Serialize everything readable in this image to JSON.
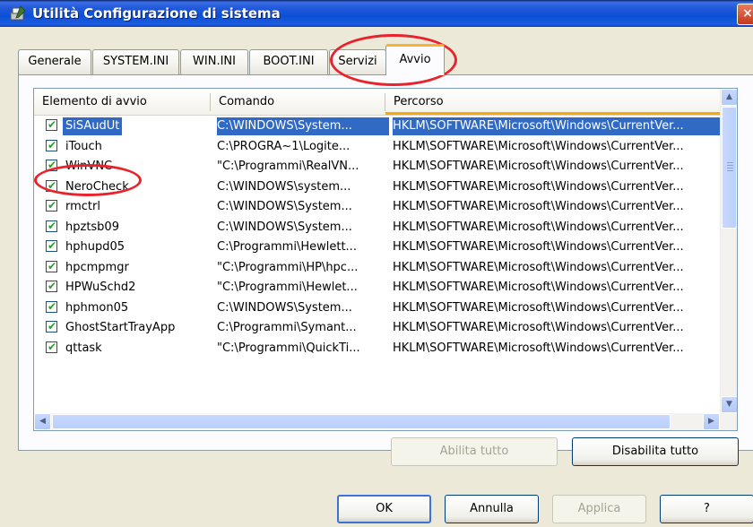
{
  "window": {
    "title": "Utilità Configurazione di sistema",
    "close_label": "×"
  },
  "tabs": [
    {
      "label": "Generale",
      "active": false
    },
    {
      "label": "SYSTEM.INI",
      "active": false
    },
    {
      "label": "WIN.INI",
      "active": false
    },
    {
      "label": "BOOT.INI",
      "active": false
    },
    {
      "label": "Servizi",
      "active": false
    },
    {
      "label": "Avvio",
      "active": true
    }
  ],
  "list": {
    "columns": [
      "Elemento di avvio",
      "Comando",
      "Percorso"
    ],
    "rows": [
      {
        "checked": true,
        "selected": true,
        "name": "SiSAudUt",
        "command": "C:\\WINDOWS\\System...",
        "path": "HKLM\\SOFTWARE\\Microsoft\\Windows\\CurrentVer..."
      },
      {
        "checked": true,
        "selected": false,
        "name": "iTouch",
        "command": "C:\\PROGRA~1\\Logite...",
        "path": "HKLM\\SOFTWARE\\Microsoft\\Windows\\CurrentVer..."
      },
      {
        "checked": true,
        "selected": false,
        "name": "WinVNC",
        "command": "\"C:\\Programmi\\RealVN...",
        "path": "HKLM\\SOFTWARE\\Microsoft\\Windows\\CurrentVer..."
      },
      {
        "checked": true,
        "selected": false,
        "name": "NeroCheck",
        "command": "C:\\WINDOWS\\system...",
        "path": "HKLM\\SOFTWARE\\Microsoft\\Windows\\CurrentVer..."
      },
      {
        "checked": true,
        "selected": false,
        "name": "rmctrl",
        "command": "C:\\WINDOWS\\System...",
        "path": "HKLM\\SOFTWARE\\Microsoft\\Windows\\CurrentVer..."
      },
      {
        "checked": true,
        "selected": false,
        "name": "hpztsb09",
        "command": "C:\\WINDOWS\\System...",
        "path": "HKLM\\SOFTWARE\\Microsoft\\Windows\\CurrentVer..."
      },
      {
        "checked": true,
        "selected": false,
        "name": "hphupd05",
        "command": "C:\\Programmi\\Hewlett...",
        "path": "HKLM\\SOFTWARE\\Microsoft\\Windows\\CurrentVer..."
      },
      {
        "checked": true,
        "selected": false,
        "name": "hpcmpmgr",
        "command": "\"C:\\Programmi\\HP\\hpc...",
        "path": "HKLM\\SOFTWARE\\Microsoft\\Windows\\CurrentVer..."
      },
      {
        "checked": true,
        "selected": false,
        "name": "HPWuSchd2",
        "command": "\"C:\\Programmi\\Hewlet...",
        "path": "HKLM\\SOFTWARE\\Microsoft\\Windows\\CurrentVer..."
      },
      {
        "checked": true,
        "selected": false,
        "name": "hphmon05",
        "command": "C:\\WINDOWS\\System...",
        "path": "HKLM\\SOFTWARE\\Microsoft\\Windows\\CurrentVer..."
      },
      {
        "checked": true,
        "selected": false,
        "name": "GhostStartTrayApp",
        "command": "C:\\Programmi\\Symant...",
        "path": "HKLM\\SOFTWARE\\Microsoft\\Windows\\CurrentVer..."
      },
      {
        "checked": true,
        "selected": false,
        "name": "qttask",
        "command": "\"C:\\Programmi\\QuickTi...",
        "path": "HKLM\\SOFTWARE\\Microsoft\\Windows\\CurrentVer..."
      }
    ]
  },
  "actions": {
    "enable_all": "Abilita tutto",
    "disable_all": "Disabilita tutto"
  },
  "footer": {
    "ok": "OK",
    "cancel": "Annulla",
    "apply": "Applica",
    "help": "?"
  },
  "colors": {
    "selection": "#316AC5",
    "annotation": "#E8232C",
    "titlebar": "#0A50D6"
  }
}
